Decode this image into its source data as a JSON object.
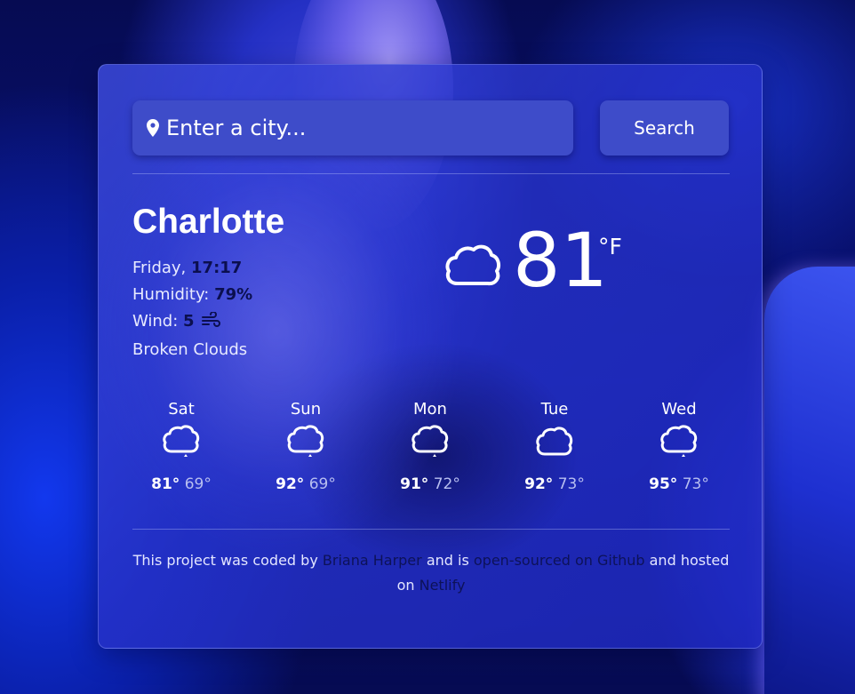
{
  "search": {
    "placeholder": "Enter a city...",
    "button_label": "Search"
  },
  "current": {
    "city": "Charlotte",
    "day_label": "Friday,",
    "time": "17:17",
    "humidity_label": "Humidity:",
    "humidity_value": "79%",
    "wind_label": "Wind:",
    "wind_value": "5",
    "description": "Broken Clouds",
    "temperature": "81",
    "unit": "°F",
    "icon": "cloud-icon"
  },
  "forecast": [
    {
      "day": "Sat",
      "high": "81°",
      "low": "69°",
      "icon": "cloud-icon"
    },
    {
      "day": "Sun",
      "high": "92°",
      "low": "69°",
      "icon": "cloud-icon"
    },
    {
      "day": "Mon",
      "high": "91°",
      "low": "72°",
      "icon": "cloud-icon"
    },
    {
      "day": "Tue",
      "high": "92°",
      "low": "73°",
      "icon": "cloud-icon"
    },
    {
      "day": "Wed",
      "high": "95°",
      "low": "73°",
      "icon": "cloud-icon"
    }
  ],
  "footer": {
    "text1": "This project was coded by",
    "author": "Briana Harper",
    "text2": "and is",
    "repo_link": "open-sourced on Github",
    "text3": "and hosted on",
    "host_link": "Netlify"
  },
  "colors": {
    "panel": "#3e4cc9",
    "accent_dark_text": "#0b0f4f",
    "background": "#050a4a"
  }
}
